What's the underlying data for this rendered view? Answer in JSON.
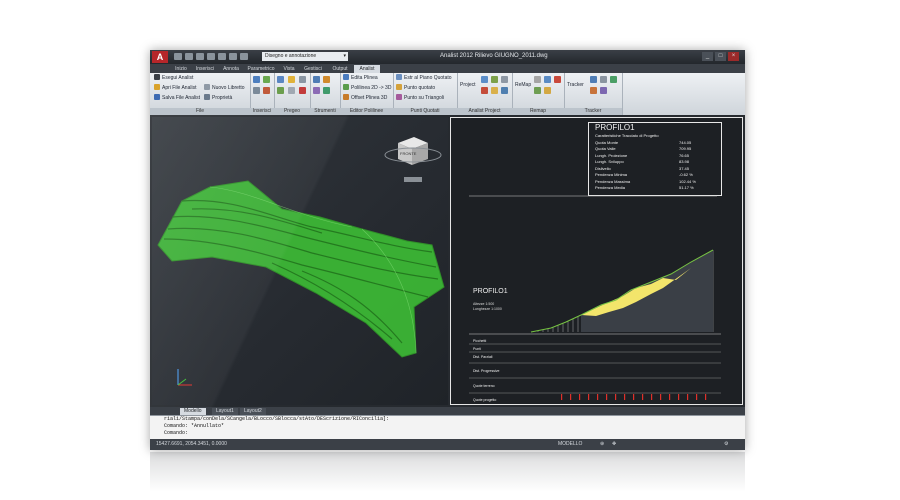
{
  "app": {
    "logo_letter": "A",
    "workspace": "Disegno e annotazione",
    "title": "Analist 2012    Rilievo GIUGNO_2011.dwg",
    "window_buttons": [
      "_",
      "□",
      "×"
    ]
  },
  "menu_tabs": [
    "Inizio",
    "Inserisci",
    "Annota",
    "Parametrico",
    "Vista",
    "Gestisci",
    "Output",
    "Analist"
  ],
  "active_tab_index": 7,
  "ribbon": {
    "file_panel": {
      "label": "File",
      "buttons": [
        "Esegui Analist",
        "Apri File Analist",
        "Nuovo Libretto",
        "Salva File Analist",
        "Proprietà"
      ]
    },
    "inserisci_panel": {
      "label": "Inserisci"
    },
    "pregeo_panel": {
      "label": "Pregeo"
    },
    "strumenti_panel": {
      "label": "Strumenti"
    },
    "polilinee_panel": {
      "label": "Editor Polilinee",
      "buttons": [
        "Edita Plinea",
        "Polilinea 2D -> 3D",
        "Offset Plinea 3D"
      ]
    },
    "quotati_panel": {
      "label": "Punti Quotati",
      "buttons": [
        "Estr al Piano Quotato",
        "Punto quotato",
        "Punto su Triangoli"
      ]
    },
    "project_panel": {
      "label": "Analist Project",
      "buttons": [
        "Project"
      ]
    },
    "remap_panel": {
      "label": "Remap",
      "buttons": [
        "ReMap"
      ]
    },
    "tracker_panel": {
      "label": "Tracker",
      "buttons": [
        "Tracker"
      ]
    }
  },
  "viewcube_label": "FRONTE",
  "profile": {
    "table_title": "PROFILO1",
    "table_subtitle": "Caratteristiche Tracciato di Progetto",
    "rows": [
      {
        "label": "Quota Monte",
        "value": "744.05"
      },
      {
        "label": "Quota Valle",
        "value": "709.95"
      },
      {
        "label": "Lungh. Proiezione",
        "value": "76.65"
      },
      {
        "label": "Lungh. Sviluppo",
        "value": "83.98"
      },
      {
        "label": "Dislivello",
        "value": "37.45"
      },
      {
        "label": "Pendenza Minima",
        "value": "-0.62 %"
      },
      {
        "label": "Pendenza Massima",
        "value": "102.44 %"
      },
      {
        "label": "Pendenza Media",
        "value": "51.17 %"
      }
    ],
    "drawing_title": "PROFILO1",
    "scale_lines": [
      "Altezze 1:500",
      "Lunghezze 1:1000"
    ],
    "row_labels": [
      "Picchetti",
      "Punti",
      "Dist. Parziali",
      "Dist. Progressive",
      "Quote terreno",
      "Quote progetto"
    ]
  },
  "layout_tabs": [
    "Modello",
    "Layout1",
    "Layout2"
  ],
  "command_lines": [
    "riali/Stampa/conDela/SCangela/BLocco/SBlocca/stAto/DEScrizione/RIConcilia]:",
    "Comando: *Annullato*",
    "Comando:"
  ],
  "status": {
    "coords": "15427.6691, 2054.3451, 0.0000",
    "mode": "MODELLO"
  },
  "colors": {
    "terrain": "#3dbe35",
    "profile_fill": "#f3e56b",
    "profile_line": "#77c443",
    "highlight_red": "#e0302a",
    "autocad_red": "#b6262a"
  }
}
